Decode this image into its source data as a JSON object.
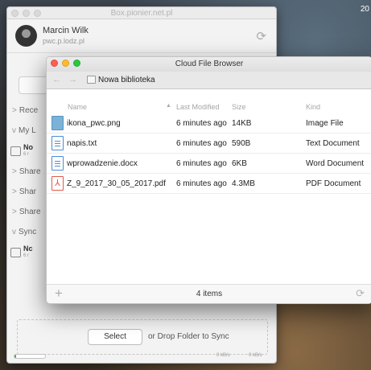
{
  "desktop": {
    "clock": "20"
  },
  "back_window": {
    "title": "Box.pionier.net.pl",
    "user": {
      "name": "Marcin Wilk",
      "host": "pwc.p.lodz.pl"
    },
    "sync_icon": "sync-icon",
    "sidebar": {
      "items": [
        {
          "chevron": ">",
          "label": "Rece"
        },
        {
          "chevron": "v",
          "label": "My L"
        },
        {
          "type": "library",
          "title": "No",
          "subtitle": "6 r"
        },
        {
          "chevron": ">",
          "label": "Share"
        },
        {
          "chevron": ">",
          "label": "Shar"
        },
        {
          "chevron": ">",
          "label": "Share"
        },
        {
          "chevron": "v",
          "label": "Sync"
        },
        {
          "type": "library",
          "title": "Nc",
          "subtitle": "6 r"
        }
      ]
    },
    "dropzone": {
      "select_label": "Select",
      "drop_text": "or Drop Folder to Sync"
    },
    "footer": {
      "progress": 0.05,
      "upload_rate": "0 kB/s",
      "download_rate": "0 kB/s"
    }
  },
  "front_window": {
    "title": "Cloud File Browser",
    "nav": {
      "back": "←",
      "forward": "→"
    },
    "breadcrumb": "Nowa biblioteka",
    "columns": {
      "name": "Name",
      "modified": "Last Modified",
      "size": "Size",
      "kind": "Kind"
    },
    "files": [
      {
        "name": "ikona_pwc.png",
        "modified": "6 minutes ago",
        "size": "14KB",
        "kind": "Image File",
        "icon": "image-file-icon"
      },
      {
        "name": "napis.txt",
        "modified": "6 minutes ago",
        "size": "590B",
        "kind": "Text Document",
        "icon": "text-file-icon"
      },
      {
        "name": "wprowadzenie.docx",
        "modified": "6 minutes ago",
        "size": "6KB",
        "kind": "Word Document",
        "icon": "word-file-icon"
      },
      {
        "name": "Z_9_2017_30_05_2017.pdf",
        "modified": "6 minutes ago",
        "size": "4.3MB",
        "kind": "PDF Document",
        "icon": "pdf-file-icon"
      }
    ],
    "status": {
      "count": "4 items"
    },
    "colors": {
      "close": "#fc5f57",
      "minimize": "#fdbc2e",
      "zoom": "#28c940"
    }
  }
}
